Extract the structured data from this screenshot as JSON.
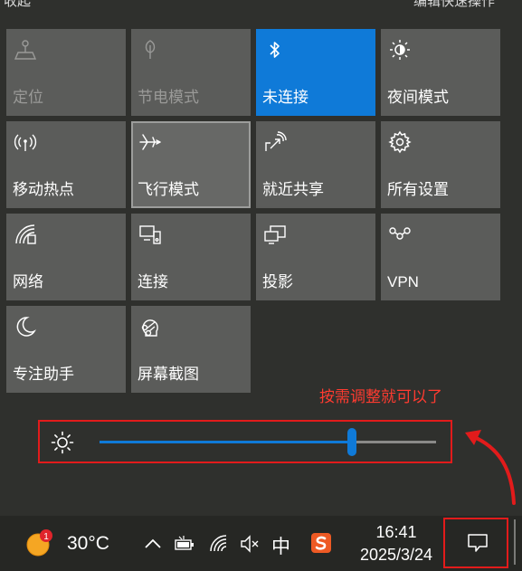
{
  "quick_actions": {
    "tiles": [
      {
        "label": "定位",
        "icon": "location-icon",
        "state": "disabled"
      },
      {
        "label": "节电模式",
        "icon": "battery-saver-icon",
        "state": "disabled"
      },
      {
        "label": "未连接",
        "icon": "bluetooth-icon",
        "state": "active"
      },
      {
        "label": "夜间模式",
        "icon": "night-light-icon",
        "state": "normal"
      },
      {
        "label": "移动热点",
        "icon": "hotspot-icon",
        "state": "normal"
      },
      {
        "label": "飞行模式",
        "icon": "airplane-icon",
        "state": "focused"
      },
      {
        "label": "就近共享",
        "icon": "nearby-share-icon",
        "state": "normal"
      },
      {
        "label": "所有设置",
        "icon": "gear-icon",
        "state": "normal"
      },
      {
        "label": "网络",
        "icon": "network-icon",
        "state": "normal"
      },
      {
        "label": "连接",
        "icon": "connect-icon",
        "state": "normal"
      },
      {
        "label": "投影",
        "icon": "project-icon",
        "state": "normal"
      },
      {
        "label": "VPN",
        "icon": "vpn-icon",
        "state": "normal"
      },
      {
        "label": "专注助手",
        "icon": "focus-assist-icon",
        "state": "normal"
      },
      {
        "label": "屏幕截图",
        "icon": "screen-snip-icon",
        "state": "normal"
      }
    ]
  },
  "annotation": "按需调整就可以了",
  "brightness": {
    "level": 0.75,
    "icon": "sun-icon"
  },
  "colors": {
    "accent": "#0f7ad8",
    "highlight_border": "#e21b1b",
    "annotation_text": "#ff3b30",
    "tile": "#5b5c5a"
  },
  "taskbar": {
    "weather_badge": "1",
    "temperature": "30°C",
    "input_method": "中",
    "time": "16:41",
    "date": "2025/3/24"
  }
}
